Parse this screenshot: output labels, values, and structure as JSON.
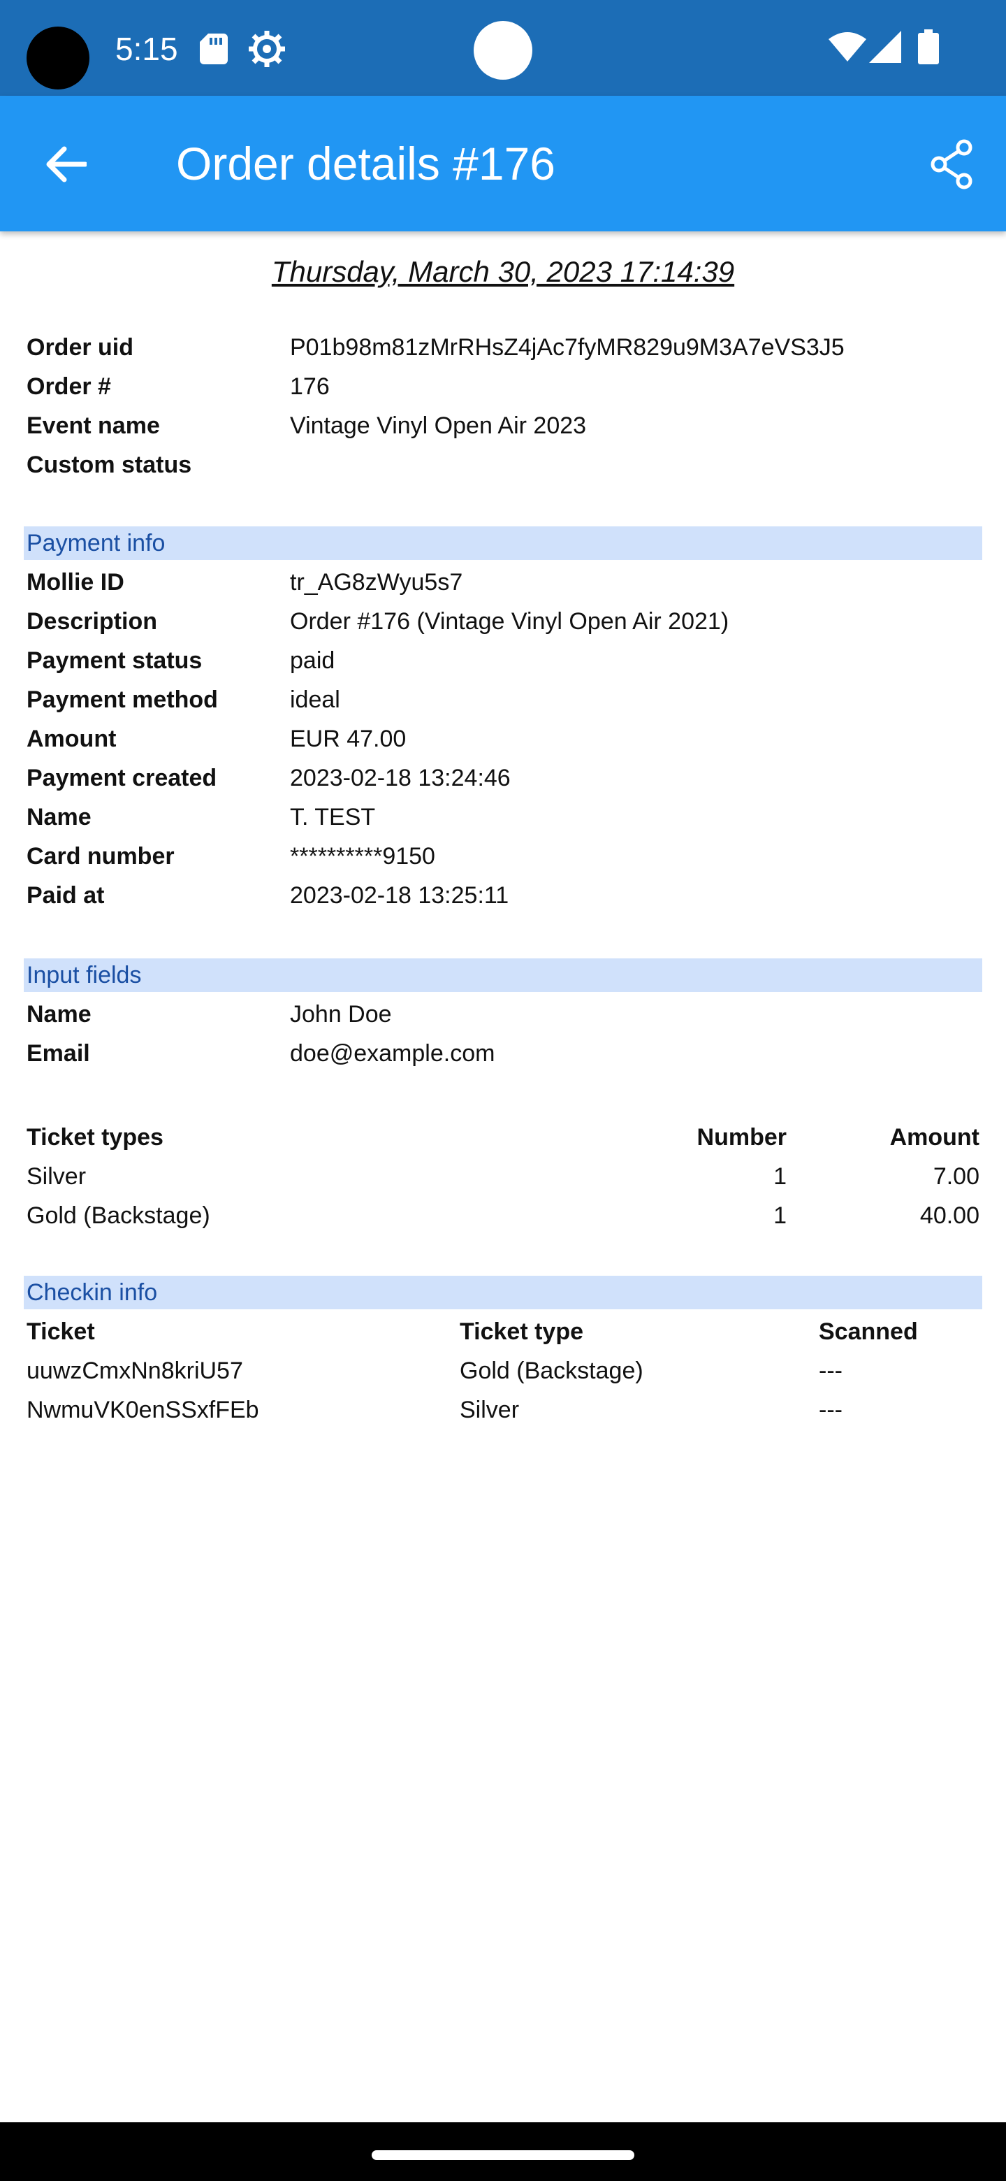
{
  "status_bar": {
    "time": "5:15",
    "icons": [
      "sd-card-icon",
      "settings-icon",
      "wifi-icon",
      "signal-icon",
      "battery-icon"
    ],
    "background_color": "#1c6db6"
  },
  "app_bar": {
    "title": "Order details #176",
    "back_icon": "arrow-left-icon",
    "share_icon": "share-icon",
    "background_color": "#2196f3"
  },
  "date": "Thursday, March 30, 2023 17:14:39",
  "order": {
    "rows": [
      {
        "label": "Order uid",
        "value": "P01b98m81zMrRHsZ4jAc7fyMR829u9M3A7eVS3J5"
      },
      {
        "label": "Order #",
        "value": "176"
      },
      {
        "label": "Event name",
        "value": "Vintage Vinyl Open Air 2023"
      },
      {
        "label": "Custom status",
        "value": ""
      }
    ]
  },
  "payment_info": {
    "header": "Payment info",
    "rows": [
      {
        "label": "Mollie ID",
        "value": "tr_AG8zWyu5s7"
      },
      {
        "label": "Description",
        "value": "Order #176 (Vintage Vinyl Open Air 2021)"
      },
      {
        "label": "Payment status",
        "value": "paid"
      },
      {
        "label": "Payment method",
        "value": "ideal"
      },
      {
        "label": "Amount",
        "value": "EUR 47.00"
      },
      {
        "label": "Payment created",
        "value": "2023-02-18 13:24:46"
      },
      {
        "label": "Name",
        "value": "T. TEST"
      },
      {
        "label": "Card number",
        "value": "**********9150"
      },
      {
        "label": "Paid at",
        "value": "2023-02-18 13:25:11"
      }
    ]
  },
  "input_fields": {
    "header": "Input fields",
    "rows": [
      {
        "label": "Name",
        "value": "John Doe"
      },
      {
        "label": "Email",
        "value": "doe@example.com"
      }
    ]
  },
  "ticket_types": {
    "columns": [
      "Ticket types",
      "Number",
      "Amount"
    ],
    "rows": [
      [
        "Silver",
        "1",
        "7.00"
      ],
      [
        "Gold (Backstage)",
        "1",
        "40.00"
      ]
    ]
  },
  "checkin_info": {
    "header": "Checkin info",
    "columns": [
      "Ticket",
      "Ticket type",
      "Scanned"
    ],
    "rows": [
      [
        "uuwzCmxNn8kriU57",
        "Gold (Backstage)",
        "---"
      ],
      [
        "NwmuVK0enSSxfFEb",
        "Silver",
        "---"
      ]
    ]
  },
  "colors": {
    "section_header_bg": "#d0e1fb",
    "section_header_text": "#1a4fa3"
  }
}
